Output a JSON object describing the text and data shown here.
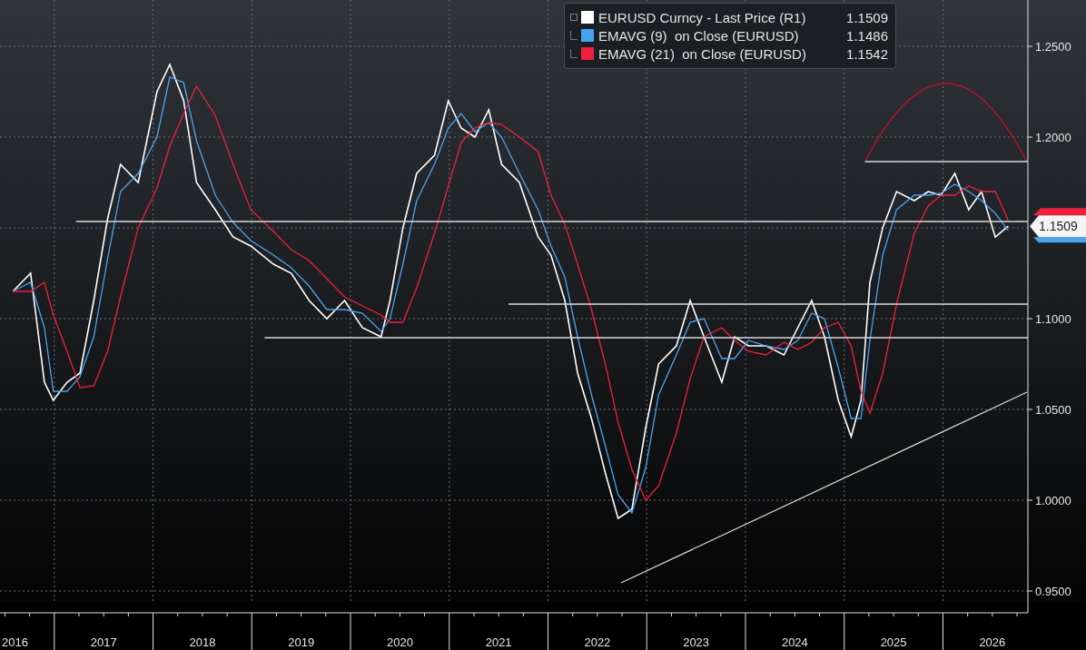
{
  "chart": {
    "legend": [
      {
        "value": "1.1509"
      },
      {
        "value": "1.1486"
      },
      {
        "value": "1.1542"
      }
    ],
    "last_price_label": "1.1509",
    "chart_data": {
      "type": "line",
      "x": [
        2016.58,
        2016.76,
        2016.9,
        2016.99,
        2017.13,
        2017.26,
        2017.4,
        2017.54,
        2017.67,
        2017.85,
        2018.04,
        2018.17,
        2018.31,
        2018.44,
        2018.63,
        2018.81,
        2018.99,
        2019.22,
        2019.4,
        2019.58,
        2019.76,
        2019.94,
        2020.12,
        2020.31,
        2020.4,
        2020.53,
        2020.67,
        2020.85,
        2020.99,
        2021.12,
        2021.26,
        2021.4,
        2021.53,
        2021.71,
        2021.9,
        2022.03,
        2022.17,
        2022.3,
        2022.44,
        2022.58,
        2022.71,
        2022.85,
        2022.99,
        2023.12,
        2023.3,
        2023.44,
        2023.58,
        2023.76,
        2023.89,
        2024.03,
        2024.21,
        2024.39,
        2024.53,
        2024.67,
        2024.8,
        2024.94,
        2025.07,
        2025.17,
        2025.26,
        2025.39,
        2025.53,
        2025.71,
        2025.85,
        2025.98,
        2026.12,
        2026.26,
        2026.39,
        2026.53,
        2026.66
      ],
      "series": [
        {
          "name": "EURUSD Curncy - Last Price (R1)",
          "color": "#ffffff",
          "values": [
            1.115,
            1.125,
            1.065,
            1.055,
            1.065,
            1.07,
            1.11,
            1.155,
            1.185,
            1.175,
            1.225,
            1.24,
            1.22,
            1.175,
            1.16,
            1.145,
            1.14,
            1.13,
            1.125,
            1.11,
            1.1,
            1.11,
            1.095,
            1.09,
            1.11,
            1.15,
            1.18,
            1.19,
            1.22,
            1.205,
            1.2,
            1.215,
            1.185,
            1.175,
            1.145,
            1.135,
            1.11,
            1.07,
            1.045,
            1.015,
            0.99,
            0.995,
            1.04,
            1.075,
            1.085,
            1.11,
            1.09,
            1.065,
            1.09,
            1.085,
            1.085,
            1.08,
            1.095,
            1.11,
            1.09,
            1.055,
            1.035,
            1.055,
            1.12,
            1.15,
            1.17,
            1.165,
            1.17,
            1.168,
            1.18,
            1.16,
            1.17,
            1.145,
            1.1509
          ]
        },
        {
          "name": "EMAVG (9)  on Close (EURUSD)",
          "color": "#4aa3f0",
          "values": [
            1.115,
            1.12,
            1.095,
            1.06,
            1.06,
            1.068,
            1.09,
            1.133,
            1.17,
            1.18,
            1.2,
            1.233,
            1.23,
            1.198,
            1.168,
            1.153,
            1.143,
            1.135,
            1.128,
            1.118,
            1.105,
            1.105,
            1.103,
            1.093,
            1.1,
            1.13,
            1.165,
            1.185,
            1.205,
            1.213,
            1.203,
            1.208,
            1.2,
            1.18,
            1.16,
            1.14,
            1.123,
            1.09,
            1.058,
            1.03,
            1.003,
            0.993,
            1.018,
            1.058,
            1.08,
            1.098,
            1.1,
            1.078,
            1.078,
            1.088,
            1.085,
            1.083,
            1.088,
            1.103,
            1.1,
            1.073,
            1.045,
            1.045,
            1.088,
            1.135,
            1.16,
            1.168,
            1.168,
            1.169,
            1.174,
            1.17,
            1.165,
            1.158,
            1.1486
          ]
        },
        {
          "name": "EMAVG (21)  on Close (EURUSD)",
          "color": "#f0203c",
          "values": [
            1.115,
            1.115,
            1.12,
            1.102,
            1.082,
            1.062,
            1.063,
            1.082,
            1.112,
            1.15,
            1.172,
            1.195,
            1.213,
            1.228,
            1.212,
            1.185,
            1.16,
            1.148,
            1.138,
            1.132,
            1.122,
            1.112,
            1.107,
            1.102,
            1.098,
            1.098,
            1.117,
            1.147,
            1.173,
            1.197,
            1.205,
            1.208,
            1.207,
            1.2,
            1.192,
            1.168,
            1.152,
            1.13,
            1.105,
            1.075,
            1.043,
            1.017,
            1.0,
            1.008,
            1.037,
            1.067,
            1.09,
            1.095,
            1.088,
            1.082,
            1.08,
            1.087,
            1.083,
            1.087,
            1.095,
            1.098,
            1.085,
            1.06,
            1.048,
            1.07,
            1.108,
            1.147,
            1.162,
            1.168,
            1.168,
            1.173,
            1.17,
            1.17,
            1.1542
          ]
        }
      ],
      "xlim": [
        2016.45,
        2026.86
      ],
      "ylim": [
        0.944,
        1.2755
      ],
      "grid": true,
      "xticks": [
        {
          "value": 2016.5,
          "label": "2016"
        },
        {
          "value": 2017.5,
          "label": "2017"
        },
        {
          "value": 2018.5,
          "label": "2018"
        },
        {
          "value": 2019.5,
          "label": "2019"
        },
        {
          "value": 2020.5,
          "label": "2020"
        },
        {
          "value": 2021.5,
          "label": "2021"
        },
        {
          "value": 2022.5,
          "label": "2022"
        },
        {
          "value": 2023.5,
          "label": "2023"
        },
        {
          "value": 2024.5,
          "label": "2024"
        },
        {
          "value": 2025.5,
          "label": "2025"
        },
        {
          "value": 2026.5,
          "label": "2026"
        }
      ],
      "yticks": [
        {
          "value": 0.95,
          "label": "0.9500"
        },
        {
          "value": 1.0,
          "label": "1.0000"
        },
        {
          "value": 1.05,
          "label": "1.0500"
        },
        {
          "value": 1.1,
          "label": "1.1000"
        },
        {
          "value": 1.2,
          "label": "1.2000"
        },
        {
          "value": 1.25,
          "label": "1.2500"
        }
      ]
    }
  }
}
